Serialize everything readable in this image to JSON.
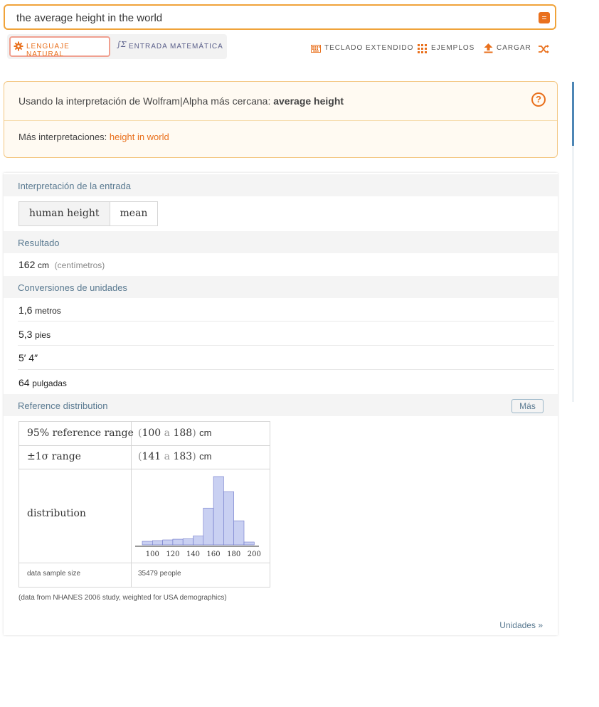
{
  "search": {
    "query": "the average height in the world"
  },
  "mode_tabs": {
    "natural": "LENGUAJE NATURAL",
    "math": "ENTRADA MATEMÁTICA"
  },
  "toolbar": {
    "keyboard": "TECLADO EXTENDIDO",
    "examples": "EJEMPLOS",
    "upload": "CARGAR"
  },
  "interpretation": {
    "prefix": "Usando la interpretación de Wolfram|Alpha más cercana: ",
    "term": "average height",
    "more_prefix": "Más interpretaciones: ",
    "more_link": "height in world"
  },
  "pods": {
    "input": {
      "title": "Interpretación de la entrada",
      "chips": [
        "human height",
        "mean"
      ]
    },
    "result": {
      "title": "Resultado",
      "value": "162",
      "unit": "cm",
      "unit_note": "(centímetros)"
    },
    "conversions": {
      "title": "Conversiones de unidades",
      "rows": [
        {
          "value": "1,6",
          "unit": "metros"
        },
        {
          "value": "5,3",
          "unit": "pies"
        },
        {
          "value": "5′ 4″",
          "unit": ""
        },
        {
          "value": "64",
          "unit": "pulgadas"
        }
      ]
    },
    "reference": {
      "title": "Reference distribution",
      "more_button": "Más",
      "range95_label": "95% reference range",
      "range95_low": "100",
      "range95_sep": "a",
      "range95_high": "188",
      "range95_unit": "cm",
      "range1s_label": "±1σ range",
      "range1s_low": "141",
      "range1s_sep": "a",
      "range1s_high": "183",
      "range1s_unit": "cm",
      "distribution_label": "distribution",
      "sample_label": "data sample size",
      "sample_value": "35479 people",
      "footnote": "(data from NHANES 2006 study, weighted for USA demographics)"
    }
  },
  "footer": {
    "units_link": "Unidades »"
  },
  "colors": {
    "accent": "#e9701d",
    "bar_fill": "#c9d0f2",
    "bar_stroke": "#6d76c9"
  },
  "chart_data": {
    "type": "bar",
    "categories": [
      "90-100",
      "100-110",
      "110-120",
      "120-130",
      "130-140",
      "140-150",
      "150-160",
      "160-170",
      "170-180",
      "180-190",
      "190-200"
    ],
    "values": [
      0.01,
      0.012,
      0.014,
      0.016,
      0.017,
      0.025,
      0.104,
      0.193,
      0.15,
      0.068,
      0.008
    ],
    "xticks": [
      "100",
      "120",
      "140",
      "160",
      "180",
      "200"
    ],
    "xlim": [
      90,
      205
    ]
  }
}
